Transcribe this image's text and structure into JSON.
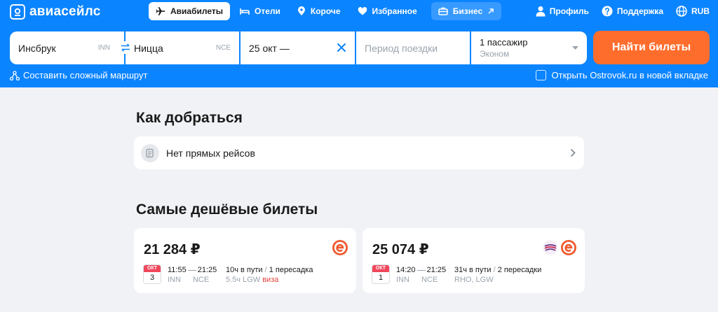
{
  "brand": {
    "name": "авиасейлс"
  },
  "nav": {
    "items": [
      {
        "label": "Авиабилеты",
        "icon": "plane-icon"
      },
      {
        "label": "Отели",
        "icon": "bed-icon"
      },
      {
        "label": "Короче",
        "icon": "map-pin-icon"
      },
      {
        "label": "Избранное",
        "icon": "heart-icon"
      }
    ],
    "business": {
      "label": "Бизнес",
      "icon": "briefcase-icon"
    }
  },
  "topbar": {
    "profile": "Профиль",
    "support": "Поддержка",
    "currency": "RUB"
  },
  "search": {
    "origin": {
      "city": "Инсбрук",
      "iata": "INN"
    },
    "destination": {
      "city": "Ницца",
      "iata": "NCE"
    },
    "depart_date": "25 окт —",
    "return_placeholder": "Период поездки",
    "passengers": "1 пассажир",
    "cabin_class": "Эконом",
    "submit_label": "Найти билеты",
    "complex_route": "Составить сложный маршрут",
    "ostrovok": "Открыть Ostrovok.ru в новой вкладке"
  },
  "how_to_get": {
    "title": "Как добраться",
    "direct_flights": "Нет прямых рейсов"
  },
  "cheapest": {
    "title": "Самые дешёвые билеты",
    "tickets": [
      {
        "price": "21 284 ₽",
        "month": "ОКТ",
        "day": "3",
        "depart_time": "11:55",
        "arrive_time": "21:25",
        "from": "INN",
        "to": "NCE",
        "duration": "10ч в пути",
        "stops": "1 пересадка",
        "layover": "5.5ч LGW",
        "visa": "виза"
      },
      {
        "price": "25 074 ₽",
        "month": "ОКТ",
        "day": "1",
        "depart_time": "14:20",
        "arrive_time": "21:25",
        "from": "INN",
        "to": "NCE",
        "duration": "31ч в пути",
        "stops": "2 пересадки",
        "layover": "RHO, LGW",
        "visa": ""
      }
    ]
  },
  "colors": {
    "header": "#0b84ff",
    "search_button": "#ff6d2d",
    "airline_logo": "#ee5a2e",
    "calendar_month": "#f1475b",
    "visa": "#e3453f"
  }
}
